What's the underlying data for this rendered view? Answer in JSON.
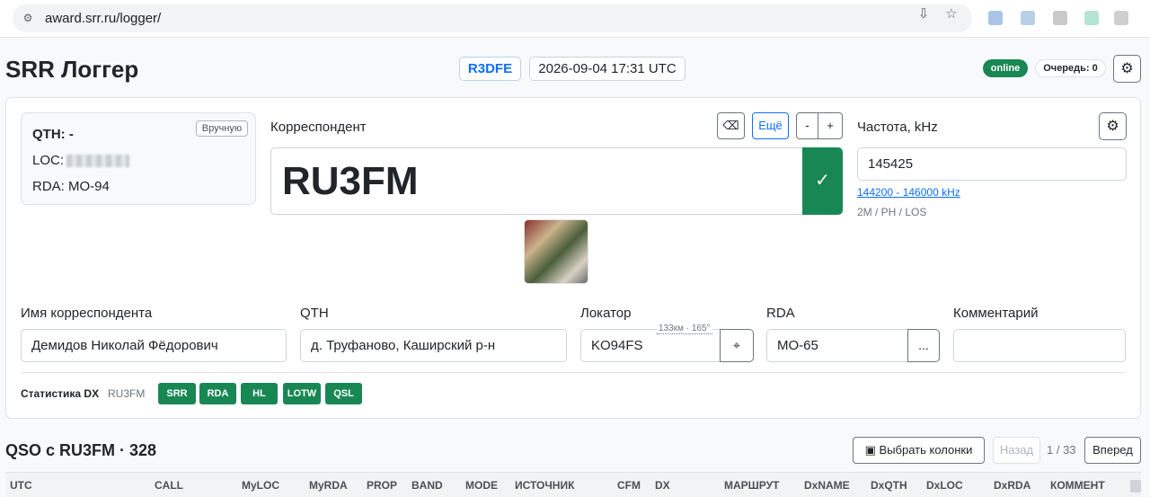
{
  "browser": {
    "url": "award.srr.ru/logger/"
  },
  "header": {
    "title": "SRR Логгер",
    "my_call": "R3DFE",
    "datetime": "2026-09-04 17:31 UTC",
    "status": "online",
    "queue": "Очередь: 0"
  },
  "qth_box": {
    "qth": "QTH: -",
    "loc_label": "LOC:",
    "rda": "RDA: MO-94",
    "manual_btn": "Вручную"
  },
  "correspondent": {
    "label": "Корреспондент",
    "more_btn": "Ещё",
    "minus_btn": "-",
    "plus_btn": "+",
    "call": "RU3FM",
    "confirm_symbol": "✓"
  },
  "frequency": {
    "label": "Частота, kHz",
    "value": "145425",
    "range": "144200 - 146000 kHz",
    "info": "2M / PH / LOS"
  },
  "fields": {
    "name_label": "Имя корреспондента",
    "name_value": "Демидов Николай Фёдорович",
    "qth_label": "QTH",
    "qth_value": "д. Труфаново, Каширский р-н",
    "locator_label": "Локатор",
    "locator_value": "KO94FS",
    "locator_distance": "133км · 165°",
    "rda_label": "RDA",
    "rda_value": "MO-65",
    "rda_more": "...",
    "comment_label": "Комментарий",
    "comment_value": ""
  },
  "stats": {
    "label": "Статистика DX",
    "call": "RU3FM",
    "badges": [
      "SRR",
      "RDA",
      "HL",
      "LOTW",
      "QSL"
    ]
  },
  "qso": {
    "title": "QSO с RU3FM · 328",
    "columns_btn": "Выбрать колонки",
    "prev_btn": "Назад",
    "page": "1 / 33",
    "next_btn": "Вперед",
    "headers": [
      "UTC",
      "CALL",
      "MyLOC",
      "MyRDA",
      "PROP",
      "BAND",
      "MODE",
      "ИСТОЧНИК",
      "CFM",
      "DX",
      "МАРШРУТ",
      "DxNAME",
      "DxQTH",
      "DxLOC",
      "DxRDA",
      "КОММЕНТ"
    ]
  },
  "colors": {
    "accent": "#0d6efd",
    "success": "#198754",
    "border": "#dee2e6"
  }
}
